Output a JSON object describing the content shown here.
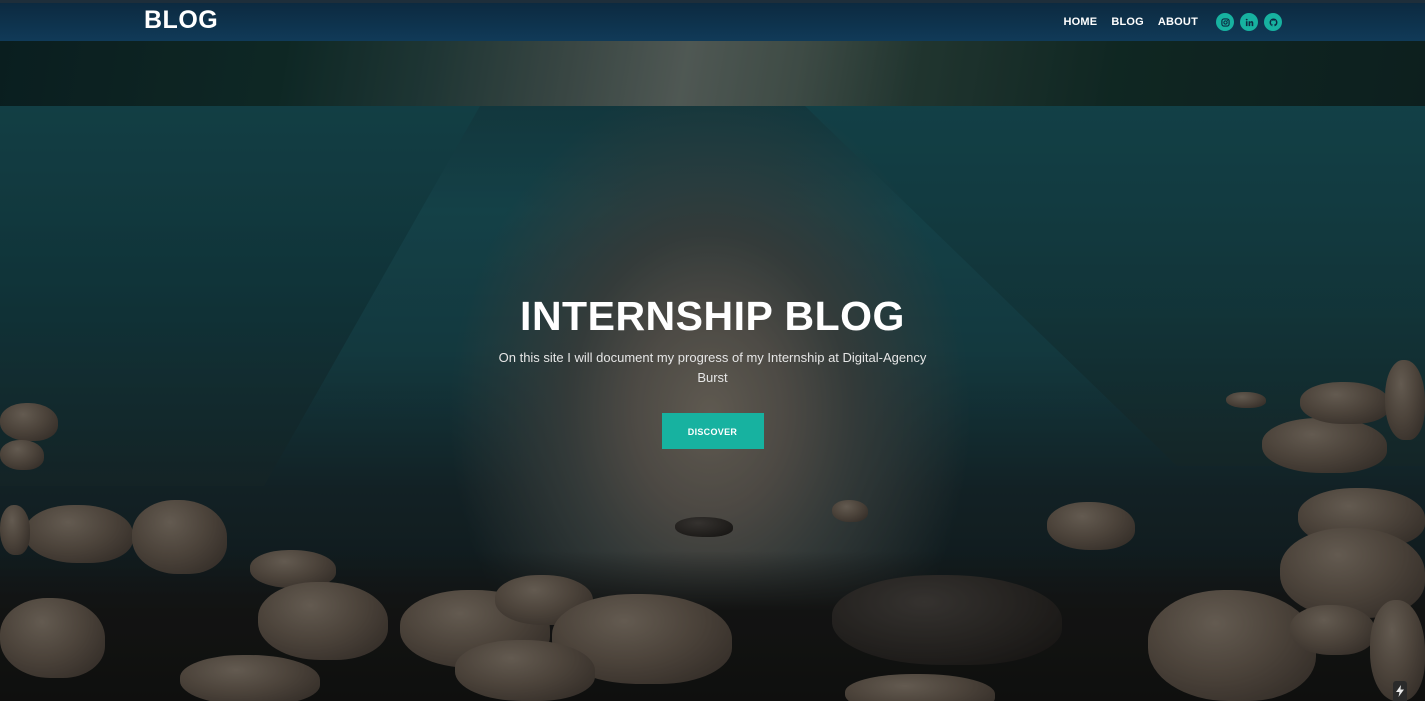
{
  "navbar": {
    "brand": "BLOG",
    "links": [
      {
        "label": "HOME"
      },
      {
        "label": "BLOG"
      },
      {
        "label": "ABOUT"
      }
    ],
    "social": [
      {
        "icon": "instagram-icon"
      },
      {
        "icon": "linkedin-icon"
      },
      {
        "icon": "github-icon"
      }
    ]
  },
  "hero": {
    "title": "INTERNSHIP BLOG",
    "subtitle": "On this site I will document my progress of my Internship at Digital-Agency Burst",
    "cta_label": "DISCOVER"
  },
  "colors": {
    "accent": "#17b2a0",
    "navbar": "#103a58",
    "text": "#ffffff"
  }
}
